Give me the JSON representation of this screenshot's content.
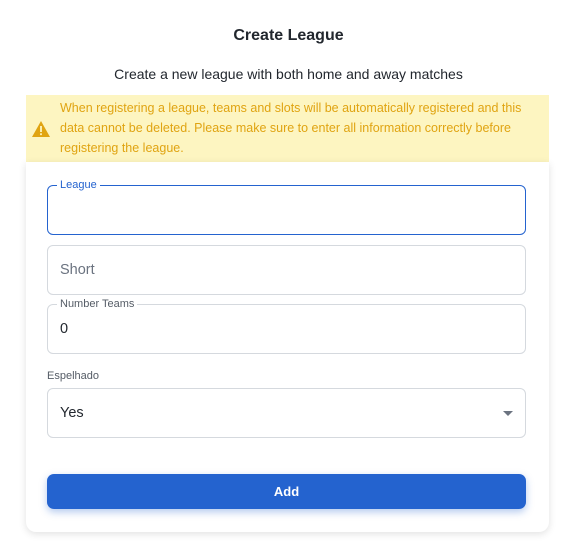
{
  "header": {
    "title": "Create League",
    "subtitle": "Create a new league with both home and away matches"
  },
  "alert": {
    "icon": "warning-icon",
    "color": "#e0a412",
    "background": "#fdf5c1",
    "message": "When registering a league, teams and slots will be automatically registered and this data cannot be deleted. Please make sure to enter all information correctly before registering the league."
  },
  "form": {
    "league": {
      "label": "League",
      "value": ""
    },
    "short": {
      "placeholder": "Short",
      "value": ""
    },
    "number_teams": {
      "label": "Number Teams",
      "value": "0"
    },
    "espelhado": {
      "label": "Espelhado",
      "value": "Yes"
    },
    "add_label": "Add"
  },
  "colors": {
    "primary": "#2463cf",
    "border": "#d5d9de"
  }
}
